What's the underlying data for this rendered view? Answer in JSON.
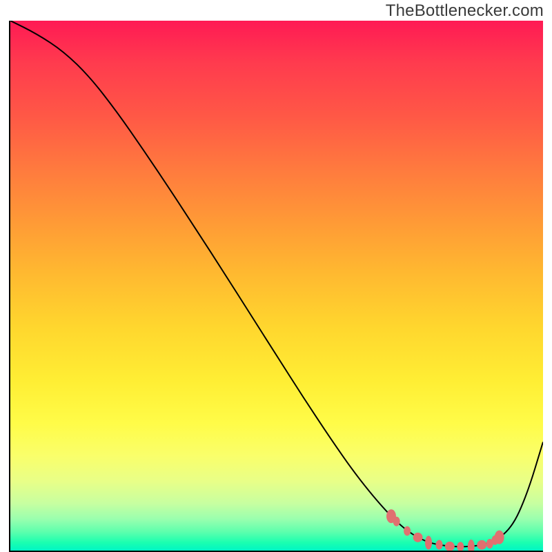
{
  "attribution": "TheBottleneсker.com",
  "chart_data": {
    "type": "line",
    "title": "",
    "xlabel": "",
    "ylabel": "",
    "xlim": [
      0,
      100
    ],
    "ylim": [
      0,
      100
    ],
    "series": [
      {
        "name": "bottleneck-curve",
        "x": [
          0,
          5,
          10,
          15,
          20,
          25,
          30,
          35,
          40,
          45,
          50,
          55,
          60,
          65,
          70,
          74,
          78,
          82,
          86,
          90,
          94,
          97,
          100
        ],
        "y": [
          100,
          97.5,
          94.2,
          89.3,
          82.8,
          75.6,
          68.1,
          60.4,
          52.6,
          44.7,
          36.8,
          28.9,
          21.3,
          14.1,
          8.0,
          4.0,
          1.6,
          0.8,
          0.7,
          1.3,
          4.0,
          10.6,
          20.5
        ]
      }
    ],
    "markers": {
      "name": "optimal-range-dots",
      "color": "#e07070",
      "x": [
        71.5,
        72.5,
        74.5,
        76.5,
        78.5,
        80.5,
        82.5,
        84.5,
        86.5,
        88.5,
        90.0,
        91.0,
        91.8
      ]
    },
    "gradient_stops": [
      {
        "pos": 0,
        "color": "#ff1a54"
      },
      {
        "pos": 50,
        "color": "#ffd72e"
      },
      {
        "pos": 80,
        "color": "#fcff58"
      },
      {
        "pos": 100,
        "color": "#00f5c4"
      }
    ]
  }
}
